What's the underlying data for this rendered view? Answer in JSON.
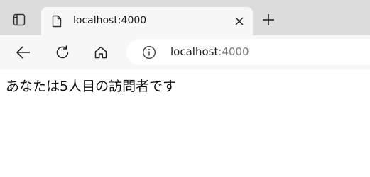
{
  "browser": {
    "tab": {
      "title": "localhost:4000"
    },
    "address_bar": {
      "host": "localhost",
      "port": ":4000"
    }
  },
  "page": {
    "message": "あなたは5人目の訪問者です"
  },
  "icons": {
    "tab_actions": "tab-actions-icon",
    "favicon": "document-icon",
    "close": "close-icon",
    "new_tab": "plus-icon",
    "back": "arrow-left-icon",
    "refresh": "refresh-icon",
    "home": "home-icon",
    "site_info": "info-icon"
  },
  "colors": {
    "tab_strip": "#dcdcdc",
    "toolbar": "#f7f7f7",
    "page_background": "#ffffff",
    "port_text": "#7a7a7a"
  }
}
